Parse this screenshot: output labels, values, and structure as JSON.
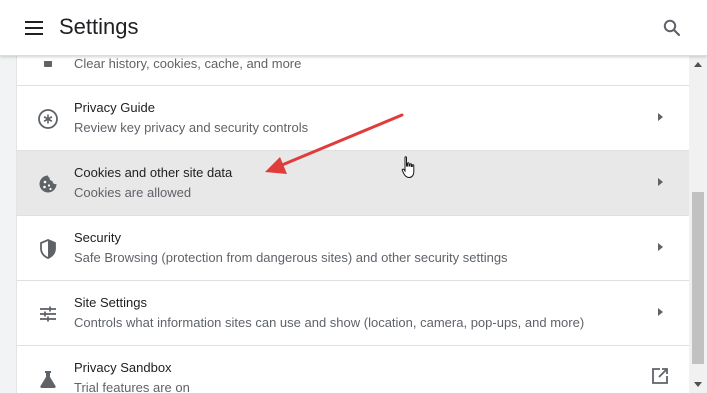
{
  "header": {
    "title": "Settings",
    "menu_icon": "hamburger-menu-icon",
    "search_icon": "search-icon"
  },
  "rows": [
    {
      "label": "",
      "sub": "Clear history, cookies, cache, and more",
      "icon": "trash-icon",
      "action": "chevron-right-icon"
    },
    {
      "label": "Privacy Guide",
      "sub": "Review key privacy and security controls",
      "icon": "privacy-guide-icon",
      "action": "chevron-right-icon"
    },
    {
      "label": "Cookies and other site data",
      "sub": "Cookies are allowed",
      "icon": "cookie-icon",
      "action": "chevron-right-icon",
      "hovered": true
    },
    {
      "label": "Security",
      "sub": "Safe Browsing (protection from dangerous sites) and other security settings",
      "icon": "shield-icon",
      "action": "chevron-right-icon"
    },
    {
      "label": "Site Settings",
      "sub": "Controls what information sites can use and show (location, camera, pop-ups, and more)",
      "icon": "sliders-icon",
      "action": "chevron-right-icon"
    },
    {
      "label": "Privacy Sandbox",
      "sub": "Trial features are on",
      "icon": "flask-icon",
      "action": "external-link-icon"
    }
  ],
  "colors": {
    "accent_arrow": "#e03c3c",
    "hover_row": "#e8e8e8",
    "background": "#f1f3f4"
  },
  "overlay": {
    "annotation": "red-arrow-pointing-to-cookies-row",
    "cursor": "hand-pointer-cursor"
  }
}
